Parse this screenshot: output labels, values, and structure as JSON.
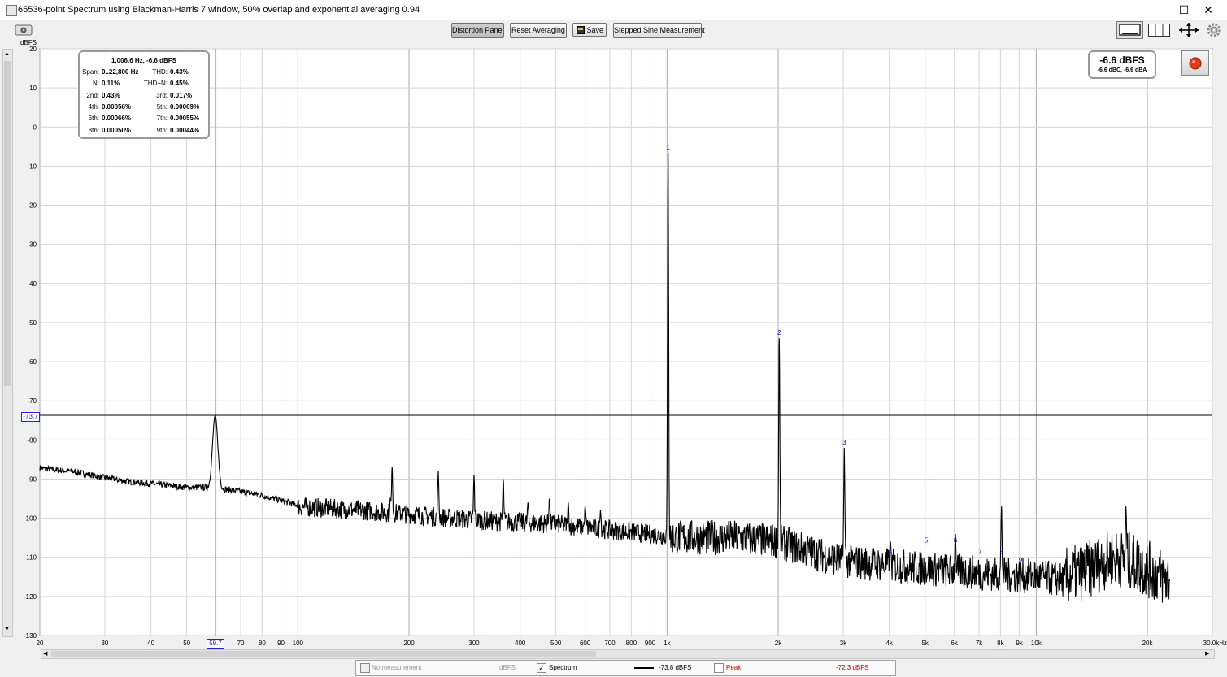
{
  "window": {
    "title": "65536-point Spectrum using Blackman-Harris 7 window, 50% overlap and exponential averaging 0.94",
    "minimize_glyph": "—",
    "maximize_glyph": "☐",
    "close_glyph": "✕"
  },
  "toolbar": {
    "distortion_panel": "Distortion Panel",
    "reset_averaging": "Reset Averaging",
    "save": "Save",
    "stepped_sine": "Stepped Sine Measurement"
  },
  "icons": [
    "camera-icon",
    "save-icon",
    "layout-single-icon",
    "layout-split-icon",
    "pan-arrows-icon",
    "gear-icon",
    "record-icon"
  ],
  "y_axis_unit": "dBFS",
  "cursor": {
    "y_readout": "-73.7",
    "x_readout": "59.7"
  },
  "distortion_panel": {
    "header": "1,006.6 Hz, -6.6 dBFS",
    "rows": [
      {
        "l_label": "Span:",
        "l_value": "0..22,800 Hz",
        "r_label": "THD:",
        "r_value": "0.43%"
      },
      {
        "l_label": "N:",
        "l_value": "0.11%",
        "r_label": "THD+N:",
        "r_value": "0.45%"
      },
      {
        "l_label": "2nd:",
        "l_value": "0.43%",
        "r_label": "3rd:",
        "r_value": "0.017%"
      },
      {
        "l_label": "4th:",
        "l_value": "0.00056%",
        "r_label": "5th:",
        "r_value": "0.00069%"
      },
      {
        "l_label": "6th:",
        "l_value": "0.00066%",
        "r_label": "7th:",
        "r_value": "0.00055%"
      },
      {
        "l_label": "8th:",
        "l_value": "0.00050%",
        "r_label": "9th:",
        "r_value": "0.00044%"
      }
    ]
  },
  "level_meter": {
    "main": "-6.6 dBFS",
    "sub": "-6.6 dBC, -6.6 dBA"
  },
  "legend": {
    "no_measurement": "No measurement",
    "no_measurement_unit": "dBFS",
    "spectrum_label": "Spectrum",
    "spectrum_value": "-73.8 dBFS",
    "peak_label": "Peak",
    "peak_value": "-72.3 dBFS",
    "spectrum_checked": "✓"
  },
  "colors": {
    "trace": "#000000",
    "grid": "#c8c8c8",
    "harmonic_label": "#0000cc",
    "peak": "#cc0000",
    "record": "#e23b1c"
  },
  "chart_data": {
    "type": "line",
    "x_scale": "log",
    "xlim": [
      20,
      30000
    ],
    "ylim": [
      -130,
      20
    ],
    "ylabel": "dBFS",
    "x_tick_labels": [
      {
        "v": 20,
        "t": "20"
      },
      {
        "v": 30,
        "t": "30"
      },
      {
        "v": 40,
        "t": "40"
      },
      {
        "v": 50,
        "t": "50"
      },
      {
        "v": 70,
        "t": "70"
      },
      {
        "v": 80,
        "t": "80"
      },
      {
        "v": 90,
        "t": "90"
      },
      {
        "v": 100,
        "t": "100"
      },
      {
        "v": 200,
        "t": "200"
      },
      {
        "v": 300,
        "t": "300"
      },
      {
        "v": 400,
        "t": "400"
      },
      {
        "v": 500,
        "t": "500"
      },
      {
        "v": 600,
        "t": "600"
      },
      {
        "v": 700,
        "t": "700"
      },
      {
        "v": 800,
        "t": "800"
      },
      {
        "v": 900,
        "t": "900"
      },
      {
        "v": 1000,
        "t": "1k"
      },
      {
        "v": 2000,
        "t": "2k"
      },
      {
        "v": 3000,
        "t": "3k"
      },
      {
        "v": 4000,
        "t": "4k"
      },
      {
        "v": 5000,
        "t": "5k"
      },
      {
        "v": 6000,
        "t": "6k"
      },
      {
        "v": 7000,
        "t": "7k"
      },
      {
        "v": 8000,
        "t": "8k"
      },
      {
        "v": 9000,
        "t": "9k"
      },
      {
        "v": 10000,
        "t": "10k"
      },
      {
        "v": 20000,
        "t": "20k"
      },
      {
        "v": 30000,
        "t": "30.0kHz"
      }
    ],
    "y_ticks": [
      20,
      10,
      0,
      -10,
      -20,
      -30,
      -40,
      -50,
      -60,
      -70,
      -80,
      -90,
      -100,
      -110,
      -120,
      -130
    ],
    "cursor_lines": {
      "x": 59.7,
      "y": -73.7
    },
    "harmonic_markers": [
      {
        "label": "1",
        "f": 1006.6,
        "db": -6.6
      },
      {
        "label": "2",
        "f": 2013,
        "db": -54
      },
      {
        "label": "3",
        "f": 3020,
        "db": -82
      },
      {
        "label": "4",
        "f": 4026,
        "db": -110
      },
      {
        "label": "5",
        "f": 5033,
        "db": -107
      },
      {
        "label": "6",
        "f": 6040,
        "db": -107
      },
      {
        "label": "7",
        "f": 7046,
        "db": -110
      },
      {
        "label": "8",
        "f": 8053,
        "db": -110
      },
      {
        "label": "9",
        "f": 9060,
        "db": -112
      }
    ],
    "series": [
      {
        "name": "Spectrum",
        "noise_floor": [
          [
            20,
            -87
          ],
          [
            25,
            -88
          ],
          [
            30,
            -89.5
          ],
          [
            35,
            -90.5
          ],
          [
            40,
            -91
          ],
          [
            45,
            -91.5
          ],
          [
            50,
            -92
          ],
          [
            55,
            -92
          ],
          [
            65,
            -92.5
          ],
          [
            80,
            -94
          ],
          [
            100,
            -96.5
          ],
          [
            150,
            -97.5
          ],
          [
            200,
            -98.5
          ],
          [
            300,
            -100
          ],
          [
            500,
            -101
          ],
          [
            700,
            -102.5
          ],
          [
            1000,
            -104
          ],
          [
            1500,
            -104
          ],
          [
            2000,
            -105
          ],
          [
            2500,
            -108
          ],
          [
            3000,
            -110
          ],
          [
            5000,
            -112
          ],
          [
            8000,
            -113.5
          ],
          [
            10000,
            -114
          ],
          [
            12000,
            -115
          ],
          [
            14000,
            -113
          ],
          [
            16000,
            -110
          ],
          [
            18000,
            -111
          ],
          [
            20000,
            -113
          ],
          [
            23000,
            -116
          ]
        ],
        "spikes": [
          {
            "f": 59.7,
            "db": -73.7
          },
          {
            "f": 180,
            "db": -87
          },
          {
            "f": 240,
            "db": -88
          },
          {
            "f": 300,
            "db": -89
          },
          {
            "f": 360,
            "db": -90
          },
          {
            "f": 178,
            "db": -95
          },
          {
            "f": 420,
            "db": -96
          },
          {
            "f": 480,
            "db": -95
          },
          {
            "f": 540,
            "db": -96
          },
          {
            "f": 600,
            "db": -97
          },
          {
            "f": 660,
            "db": -98
          },
          {
            "f": 1006.6,
            "db": -6.6
          },
          {
            "f": 2013,
            "db": -54
          },
          {
            "f": 3020,
            "db": -82
          },
          {
            "f": 4026,
            "db": -106
          },
          {
            "f": 6040,
            "db": -104
          },
          {
            "f": 8053,
            "db": -97
          },
          {
            "f": 17500,
            "db": -97
          }
        ]
      }
    ]
  }
}
